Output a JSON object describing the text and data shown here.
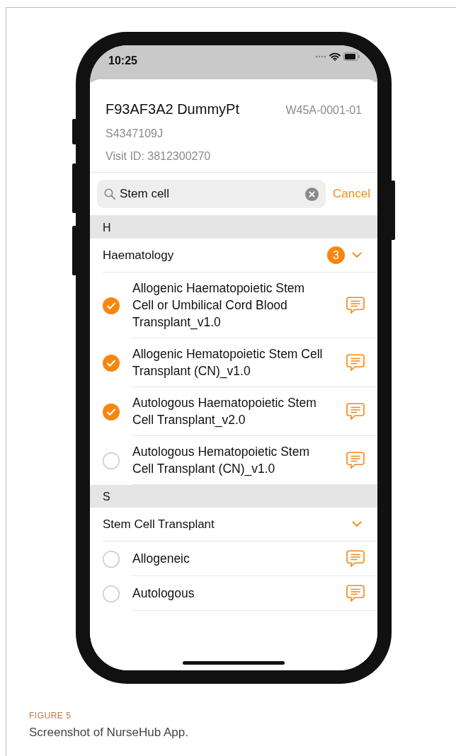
{
  "status_bar": {
    "time": "10:25"
  },
  "patient": {
    "name": "F93AF3A2 DummyPt",
    "ward": "W45A-0001-01",
    "id": "S4347109J",
    "visit": "Visit ID: 3812300270"
  },
  "search": {
    "value": "Stem cell",
    "cancel": "Cancel"
  },
  "groups": [
    {
      "letter": "H",
      "categories": [
        {
          "title": "Haematology",
          "count": "3",
          "expanded": true,
          "items": [
            {
              "label": "Allogenic Haematopoietic Stem Cell or Umbilical Cord Blood Transplant_v1.0",
              "checked": true
            },
            {
              "label": "Allogenic Hematopoietic Stem Cell Transplant (CN)_v1.0",
              "checked": true
            },
            {
              "label": "Autologous Haematopoietic Stem Cell Transplant_v2.0",
              "checked": true
            },
            {
              "label": "Autologous Hematopoietic Stem Cell Transplant (CN)_v1.0",
              "checked": false
            }
          ]
        }
      ]
    },
    {
      "letter": "S",
      "categories": [
        {
          "title": "Stem Cell Transplant",
          "expanded": true,
          "items": [
            {
              "label": "Allogeneic",
              "checked": false
            },
            {
              "label": "Autologous",
              "checked": false
            }
          ]
        }
      ]
    }
  ],
  "caption": {
    "label": "FIGURE 5",
    "text": "Screenshot of NurseHub App."
  }
}
